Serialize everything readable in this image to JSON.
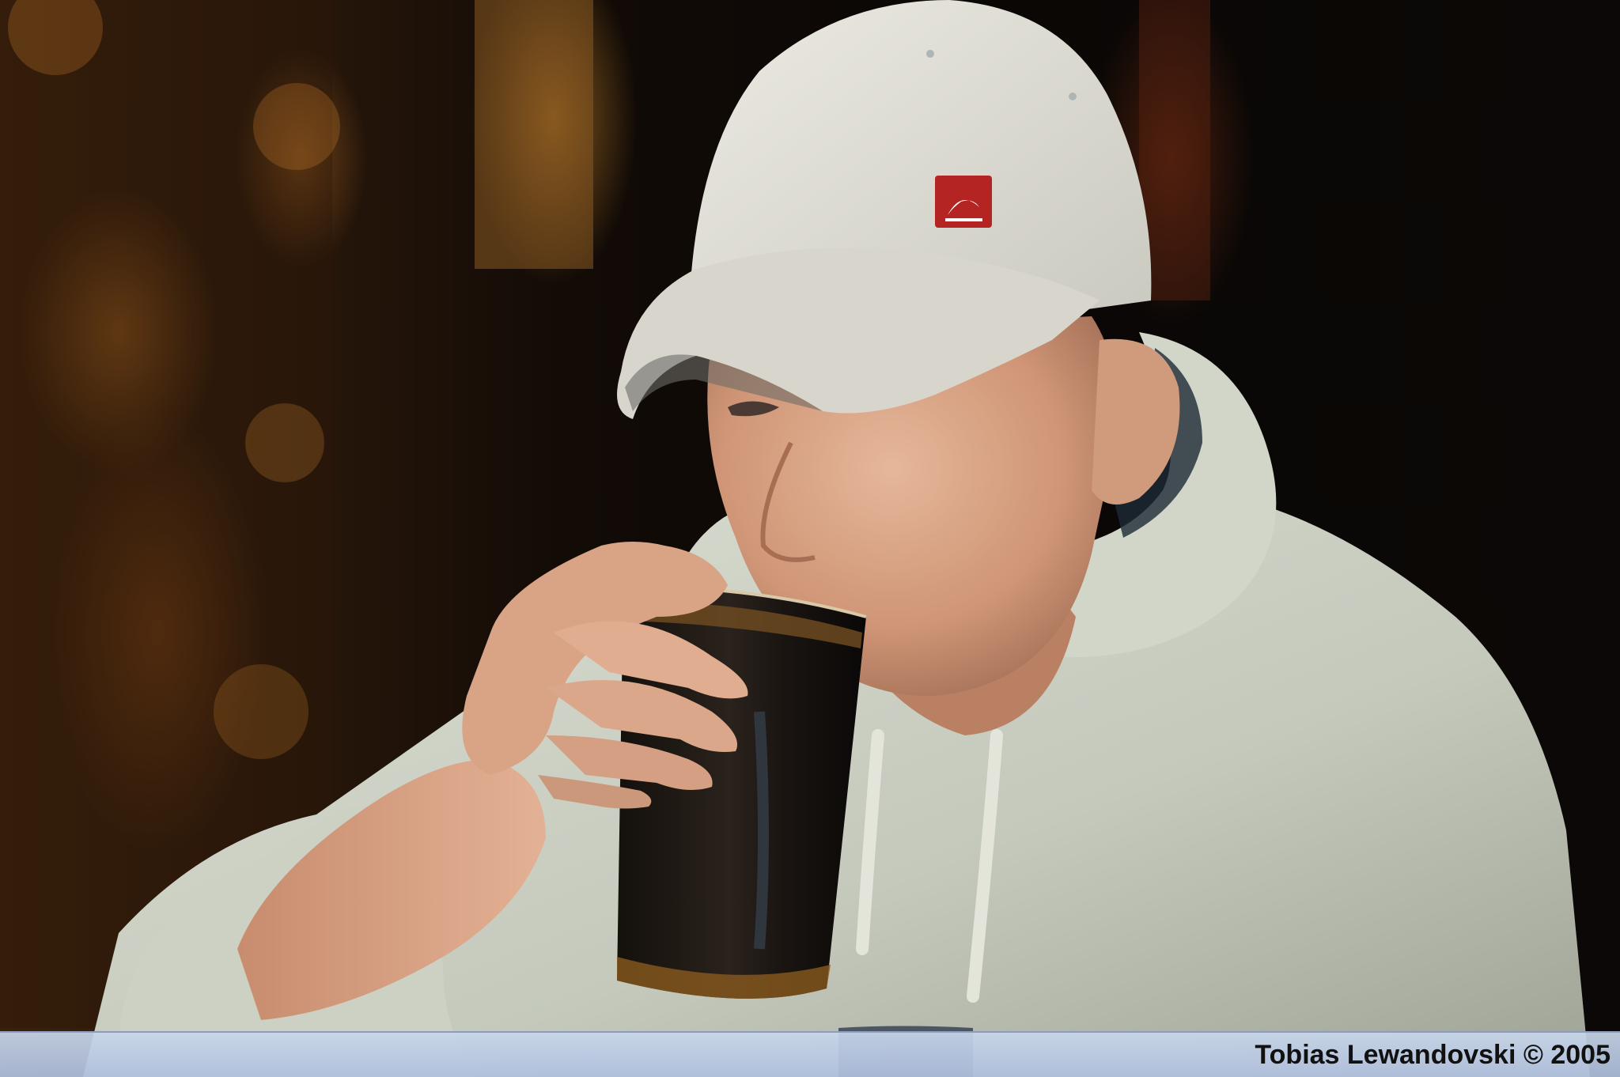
{
  "photo": {
    "credit": "Tobias Lewandovski © 2005",
    "cap_logo": "quiksilver-logo"
  }
}
